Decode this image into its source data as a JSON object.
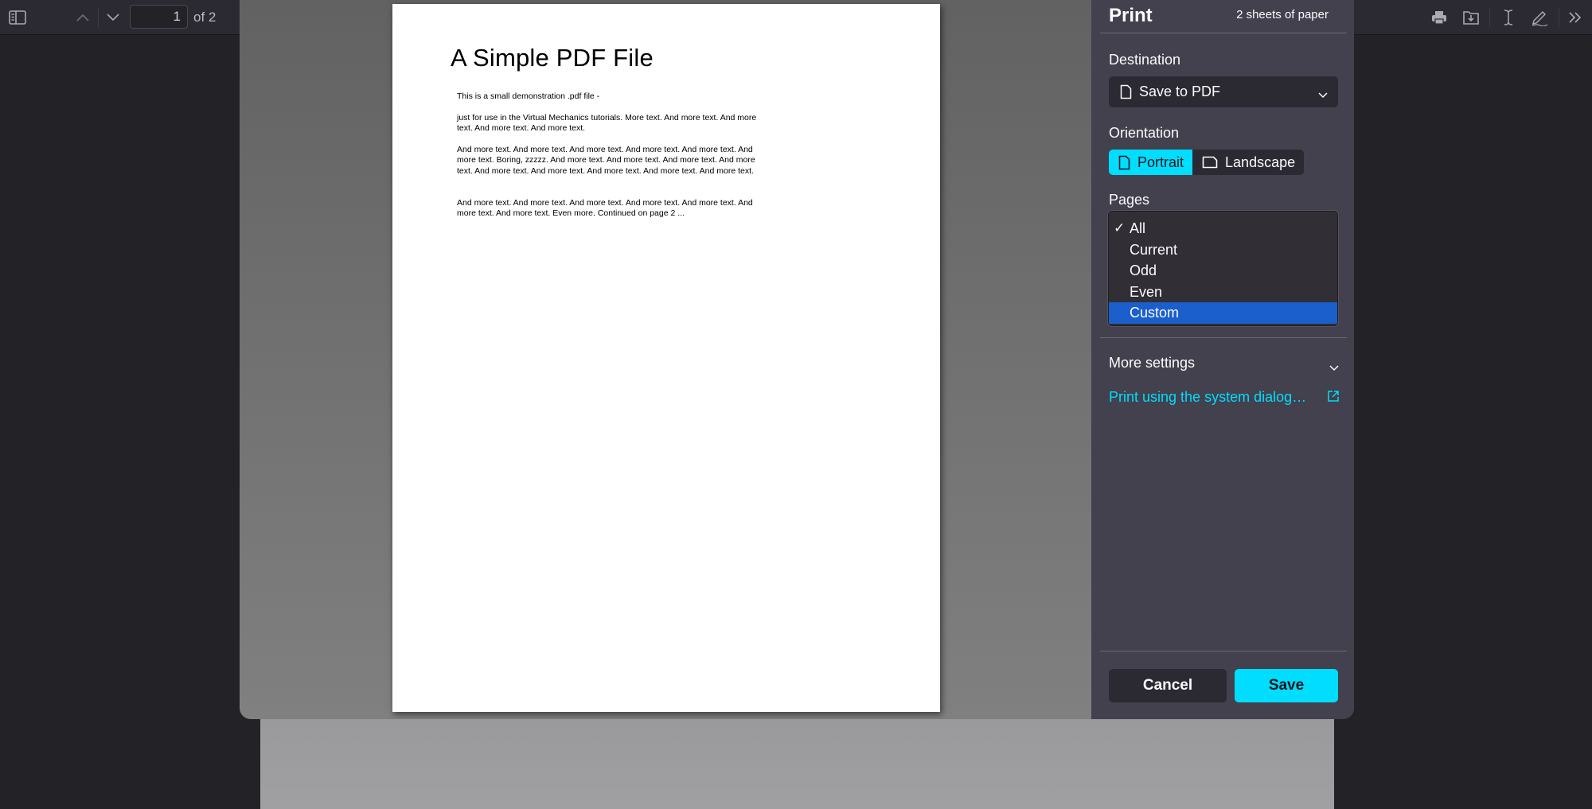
{
  "toolbar": {
    "page_current": "1",
    "page_total_label": "of 2",
    "icons": [
      "sidebar-toggle-icon",
      "previous-page-icon",
      "next-page-icon",
      "print-icon",
      "save-icon",
      "text-cursor-icon",
      "draw-icon",
      "tools-menu-icon"
    ]
  },
  "document": {
    "title": "A Simple PDF File",
    "paragraphs": [
      "This is a small demonstration .pdf file -",
      "just for use in the Virtual Mechanics tutorials. More text. And more text. And more text. And more text. And more text.",
      "And more text. And more text. And more text. And more text. And more text. And more text. Boring, zzzzz. And more text. And more text. And more text. And more text. And more text. And more text. And more text. And more text. And more text.",
      "And more text. And more text. And more text. And more text. And more text. And more text. And more text. Even more. Continued on page 2 ..."
    ]
  },
  "print": {
    "title": "Print",
    "sheets": "2 sheets of paper",
    "destination": {
      "label": "Destination",
      "value": "Save to PDF"
    },
    "orientation": {
      "label": "Orientation",
      "options": [
        "Portrait",
        "Landscape"
      ],
      "selected": "Portrait"
    },
    "pages": {
      "label": "Pages",
      "options": [
        "All",
        "Current",
        "Odd",
        "Even",
        "Custom"
      ],
      "checked": "All",
      "highlighted": "Custom"
    },
    "more_settings": "More settings",
    "system_dialog_link": "Print using the system dialog…",
    "cancel": "Cancel",
    "save": "Save"
  },
  "colors": {
    "accent": "#00ddff",
    "panel": "#42414d",
    "highlight": "#1b5fcc"
  }
}
